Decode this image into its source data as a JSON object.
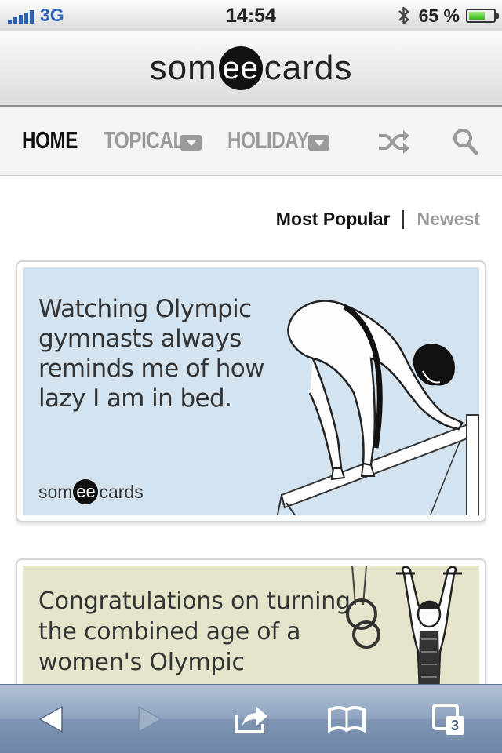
{
  "status_bar": {
    "carrier": "3G",
    "time": "14:54",
    "battery": "65 %",
    "battery_level": 0.65,
    "icons": [
      "signal-bars-icon",
      "bluetooth-icon",
      "battery-icon"
    ]
  },
  "header": {
    "logo": {
      "left": "som",
      "center": "ee",
      "right": "cards"
    }
  },
  "nav": {
    "items": [
      {
        "label": "HOME"
      },
      {
        "label": "TOPICAL"
      },
      {
        "label": "HOLIDAY"
      }
    ],
    "icons": [
      "shuffle-icon",
      "search-icon"
    ]
  },
  "sort": {
    "active": "Most Popular",
    "inactive": "Newest"
  },
  "cards": [
    {
      "lines": [
        "Watching Olympic",
        "gymnasts always",
        "reminds me of how",
        "lazy I am in bed."
      ],
      "logo": {
        "left": "som",
        "center": "ee",
        "right": "cards"
      },
      "background": "#d4e3f0"
    },
    {
      "lines": [
        "Congratulations on turning",
        "the combined age of a",
        "women's Olympic"
      ],
      "background": "#e6e5cc"
    }
  ],
  "toolbar": {
    "icons": [
      "back-arrow-icon",
      "forward-arrow-icon",
      "share-icon",
      "bookmarks-icon",
      "tabs-icon"
    ],
    "tabs_count": "3"
  },
  "colors": {
    "carrier_blue": "#2c63b8",
    "nav_active": "#111111",
    "nav_inactive": "#9a9a9a",
    "toolbar": "#8ea3bf"
  }
}
